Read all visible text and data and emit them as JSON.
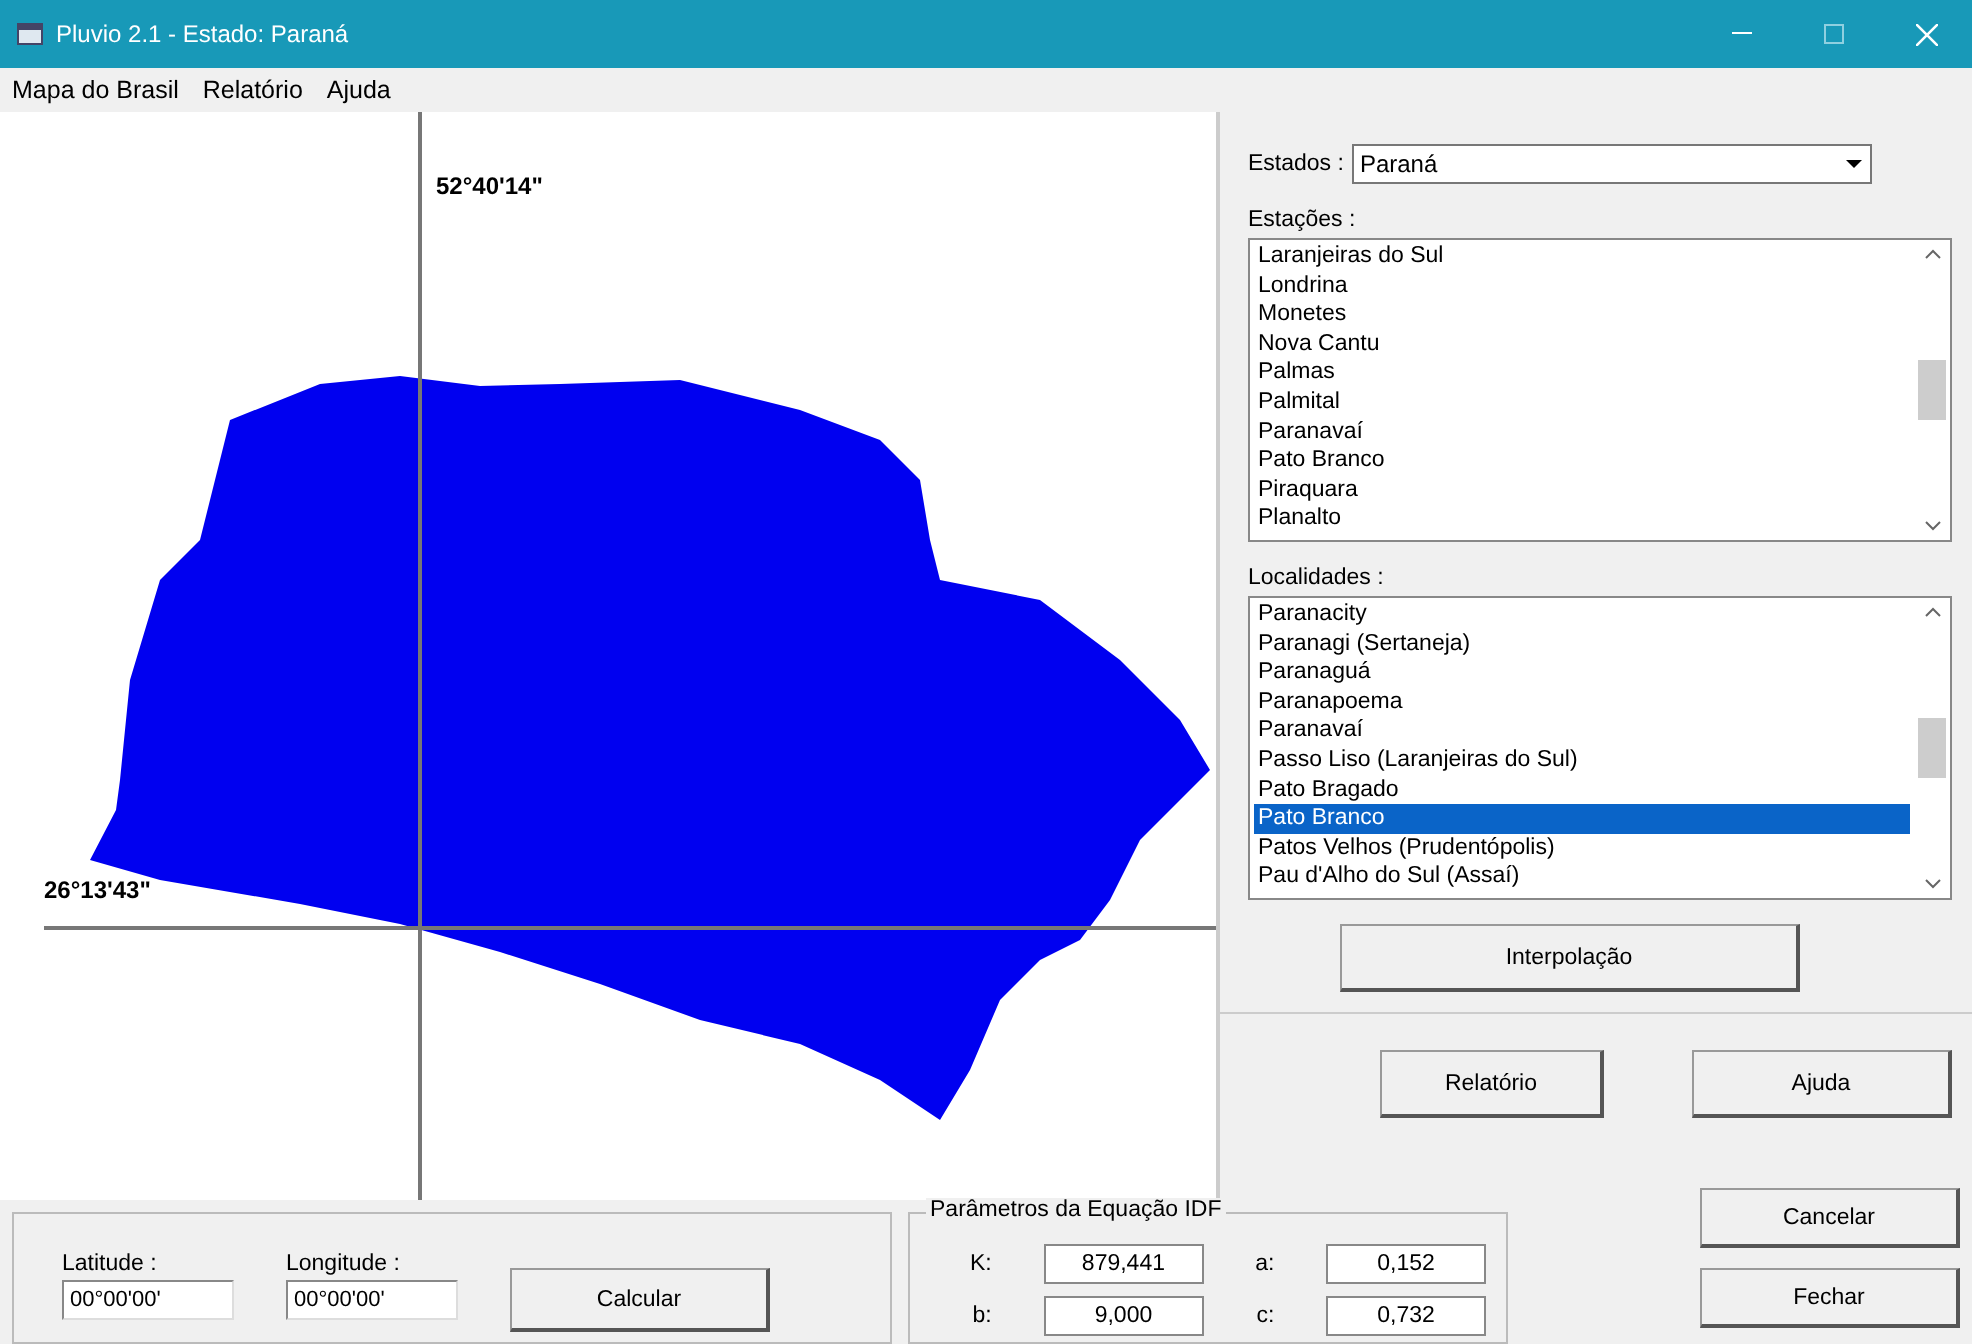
{
  "window": {
    "title": "Pluvio 2.1 - Estado: Paraná"
  },
  "menu": [
    "Mapa do Brasil",
    "Relatório",
    "Ajuda"
  ],
  "map": {
    "longitude_label": "52°40'14\"",
    "latitude_label": "26°13'43\""
  },
  "states": {
    "label": "Estados :",
    "value": "Paraná"
  },
  "stations": {
    "label": "Estações :",
    "items": [
      {
        "label": "Laranjeiras do Sul",
        "selected": false
      },
      {
        "label": "Londrina",
        "selected": false
      },
      {
        "label": "Monetes",
        "selected": false
      },
      {
        "label": "Nova Cantu",
        "selected": false
      },
      {
        "label": "Palmas",
        "selected": false
      },
      {
        "label": "Palmital",
        "selected": false
      },
      {
        "label": "Paranavaí",
        "selected": false
      },
      {
        "label": "Pato Branco",
        "selected": false
      },
      {
        "label": "Piraquara",
        "selected": false
      },
      {
        "label": "Planalto",
        "selected": false
      }
    ]
  },
  "localities": {
    "label": "Localidades :",
    "items": [
      {
        "label": "Paranacity",
        "selected": false
      },
      {
        "label": "Paranagi (Sertaneja)",
        "selected": false
      },
      {
        "label": "Paranaguá",
        "selected": false
      },
      {
        "label": "Paranapoema",
        "selected": false
      },
      {
        "label": "Paranavaí",
        "selected": false
      },
      {
        "label": "Passo Liso (Laranjeiras do Sul)",
        "selected": false
      },
      {
        "label": "Pato Bragado",
        "selected": false
      },
      {
        "label": "Pato Branco",
        "selected": true
      },
      {
        "label": "Patos Velhos (Prudentópolis)",
        "selected": false
      },
      {
        "label": "Pau d'Alho do Sul (Assaí)",
        "selected": false
      }
    ]
  },
  "interpolate_button": "Interpolação",
  "report_button": "Relatório",
  "help_button": "Ajuda",
  "coordinates": [
    {
      "label": "Latitude :",
      "value": "00°00'00'"
    },
    {
      "label": "Longitude :",
      "value": "00°00'00'"
    }
  ],
  "calculate_button": "Calcular",
  "idf": {
    "title": "Parâmetros da Equação IDF",
    "params": [
      {
        "label": "K:",
        "value": "879,441"
      },
      {
        "label": "a:",
        "value": "0,152"
      },
      {
        "label": "b:",
        "value": "9,000"
      },
      {
        "label": "c:",
        "value": "0,732"
      }
    ]
  },
  "cancel_button": "Cancelar",
  "close_button": "Fechar"
}
